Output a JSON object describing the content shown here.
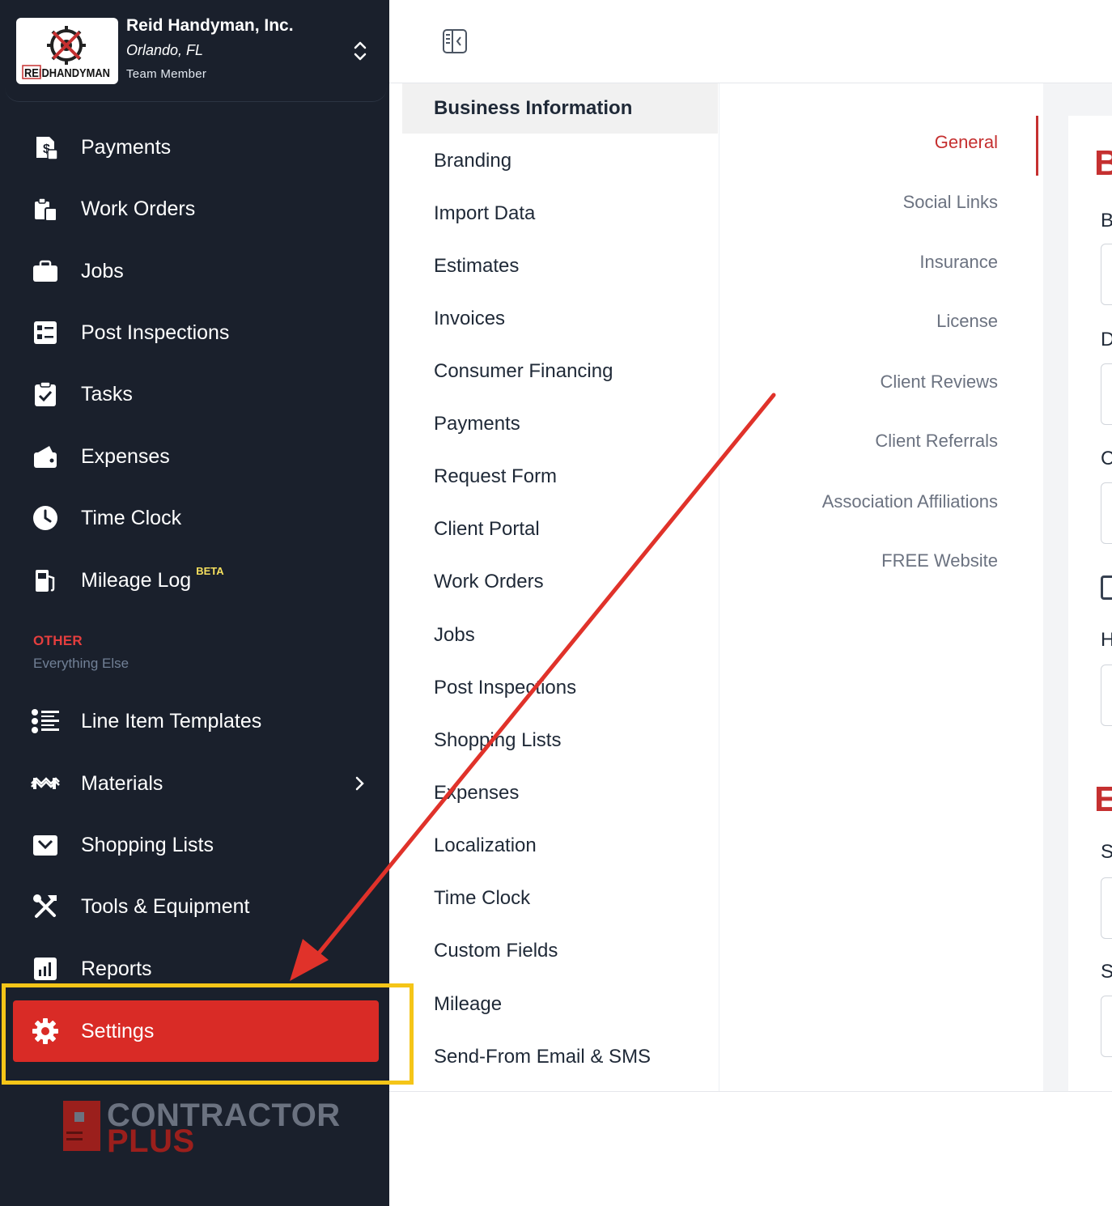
{
  "account": {
    "name": "Reid Handyman, Inc.",
    "location": "Orlando, FL",
    "role": "Team Member",
    "logo_text": "REIDHANDYMAN"
  },
  "sidebar": {
    "items": [
      {
        "label": "Payments",
        "icon": "payments-icon"
      },
      {
        "label": "Work Orders",
        "icon": "work-orders-icon"
      },
      {
        "label": "Jobs",
        "icon": "briefcase-icon"
      },
      {
        "label": "Post Inspections",
        "icon": "checklist-icon"
      },
      {
        "label": "Tasks",
        "icon": "clipboard-check-icon"
      },
      {
        "label": "Expenses",
        "icon": "wallet-icon"
      },
      {
        "label": "Time Clock",
        "icon": "clock-icon"
      },
      {
        "label": "Mileage Log",
        "badge": "BETA",
        "icon": "fuel-icon"
      }
    ],
    "section": {
      "title": "OTHER",
      "subtitle": "Everything Else"
    },
    "other_items": [
      {
        "label": "Line Item Templates",
        "icon": "list-icon"
      },
      {
        "label": "Materials",
        "icon": "materials-icon"
      },
      {
        "label": "Shopping Lists",
        "icon": "inbox-icon"
      },
      {
        "label": "Tools & Equipment",
        "icon": "tools-icon"
      },
      {
        "label": "Reports",
        "icon": "chart-icon"
      }
    ],
    "settings_label": "Settings",
    "brand": {
      "line1": "CONTRACTOR",
      "line2": "PLUS"
    }
  },
  "settings_menu": [
    "Business Information",
    "Branding",
    "Import Data",
    "Estimates",
    "Invoices",
    "Consumer Financing",
    "Payments",
    "Request Form",
    "Client Portal",
    "Work Orders",
    "Jobs",
    "Post Inspections",
    "Shopping Lists",
    "Expenses",
    "Localization",
    "Time Clock",
    "Custom Fields",
    "Mileage",
    "Send-From Email & SMS"
  ],
  "sub_tabs": [
    "General",
    "Social Links",
    "Insurance",
    "License",
    "Client Reviews",
    "Client Referrals",
    "Association Affiliations",
    "FREE Website"
  ],
  "panel": {
    "heading1": "B",
    "heading2": "E",
    "labels": [
      "B",
      "D",
      "C",
      "H",
      "S",
      "S"
    ]
  },
  "colors": {
    "sidebar_bg": "#1a202c",
    "accent_red": "#d92b26",
    "highlight_yellow": "#f5c518",
    "active_tab": "#c53030"
  }
}
